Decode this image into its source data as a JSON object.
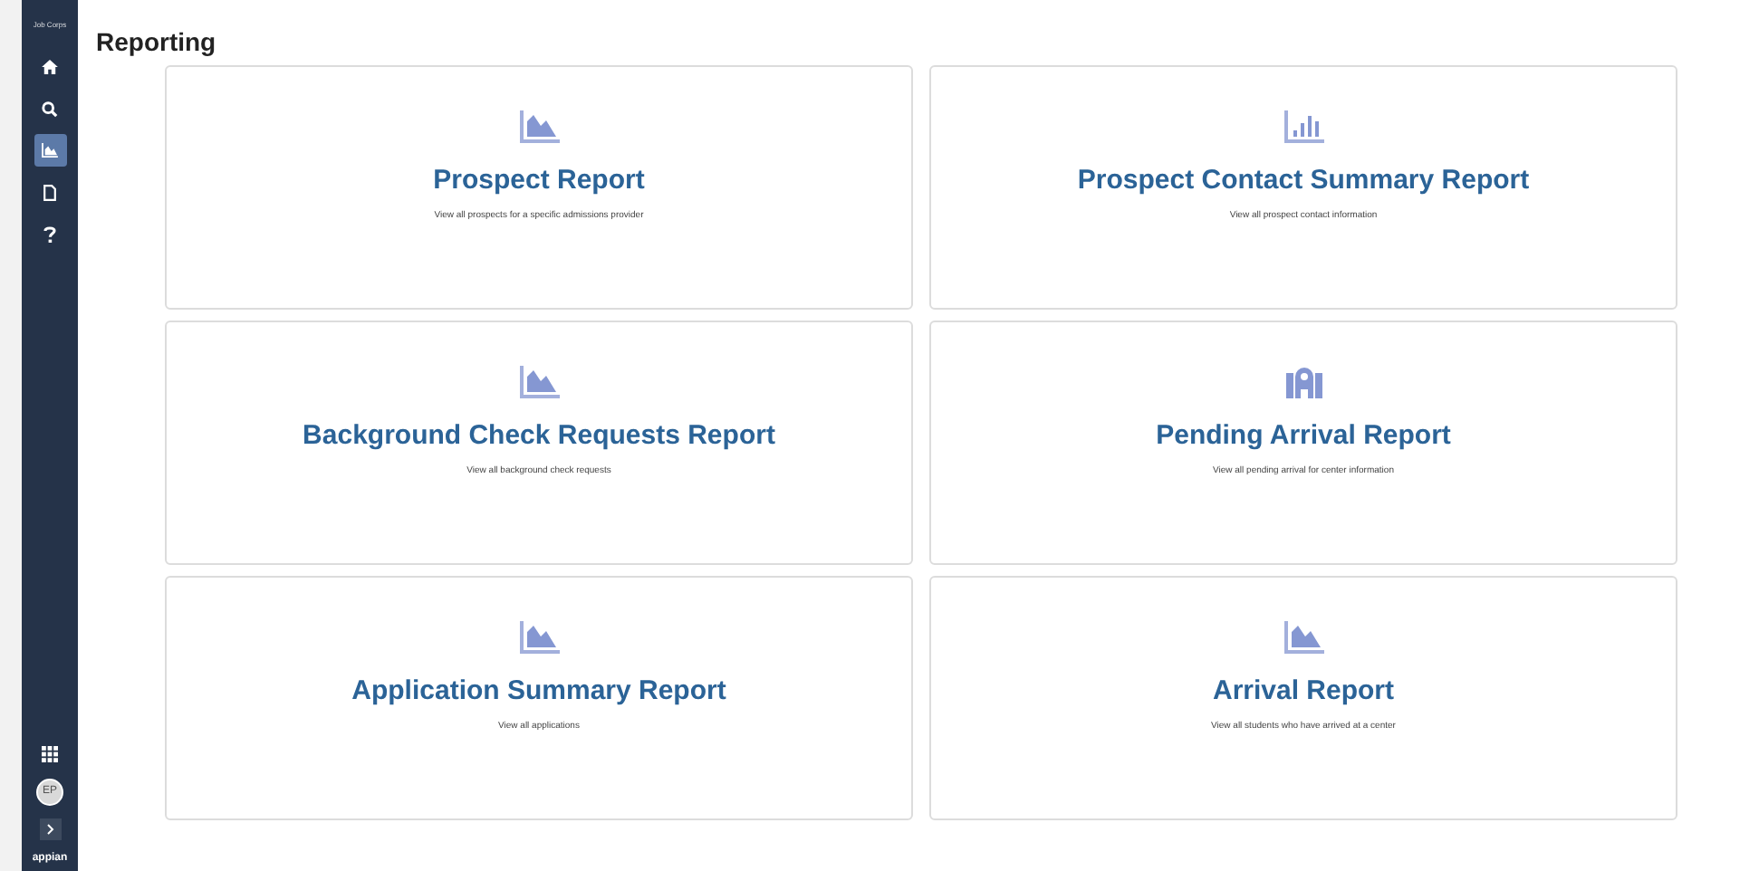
{
  "sidebar": {
    "logo": "Job Corps",
    "nav": [
      {
        "kind": "home",
        "selected": false
      },
      {
        "kind": "search",
        "selected": false
      },
      {
        "kind": "chart",
        "selected": true
      },
      {
        "kind": "document",
        "selected": false
      },
      {
        "kind": "help",
        "selected": false
      }
    ],
    "avatar": "EP",
    "brand": "appian"
  },
  "page": {
    "title": "Reporting"
  },
  "reports": [
    {
      "kind": "area",
      "title": "Prospect Report",
      "description": "View all prospects for a specific admissions provider"
    },
    {
      "kind": "bar",
      "title": "Prospect Contact Summary Report",
      "description": "View all prospect contact information"
    },
    {
      "kind": "area",
      "title": "Background Check Requests Report",
      "description": "View all background check requests"
    },
    {
      "kind": "building",
      "title": "Pending Arrival Report",
      "description": "View all pending arrival for center information"
    },
    {
      "kind": "area",
      "title": "Application Summary Report",
      "description": "View all applications"
    },
    {
      "kind": "area",
      "title": "Arrival Report",
      "description": "View all students who have arrived at a center"
    }
  ]
}
